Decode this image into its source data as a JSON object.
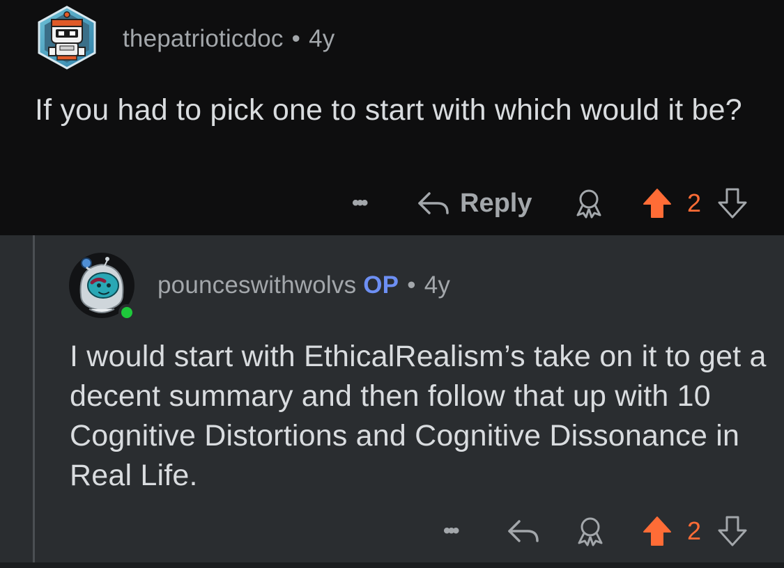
{
  "comment": {
    "username": "thepatrioticdoc",
    "separator": "•",
    "age": "4y",
    "body": "If you had to pick one to start with which would it be?",
    "actions": {
      "more_label": "•••",
      "reply_label": "Reply",
      "vote_count": "2"
    }
  },
  "reply": {
    "username": "pounceswithwolvs",
    "op_badge": "OP",
    "separator": "•",
    "age": "4y",
    "body": "I would start with EthicalRealism’s take on it to get a decent summary and then follow that up with 10 Cognitive Distortions and Cognitive Dissonance in Real Life.",
    "online": true,
    "actions": {
      "more_label": "•••",
      "vote_count": "2"
    }
  },
  "colors": {
    "background_top": "#0e0e0f",
    "background_reply": "#2a2d30",
    "text_primary": "#d9dcdf",
    "text_secondary": "#a3a7ab",
    "op_badge": "#6d8ff3",
    "upvote_active": "#ff6c36",
    "online": "#1ec93b"
  },
  "icons": [
    "reply-arrow-icon",
    "award-icon",
    "upvote-icon",
    "downvote-icon",
    "more-icon"
  ]
}
